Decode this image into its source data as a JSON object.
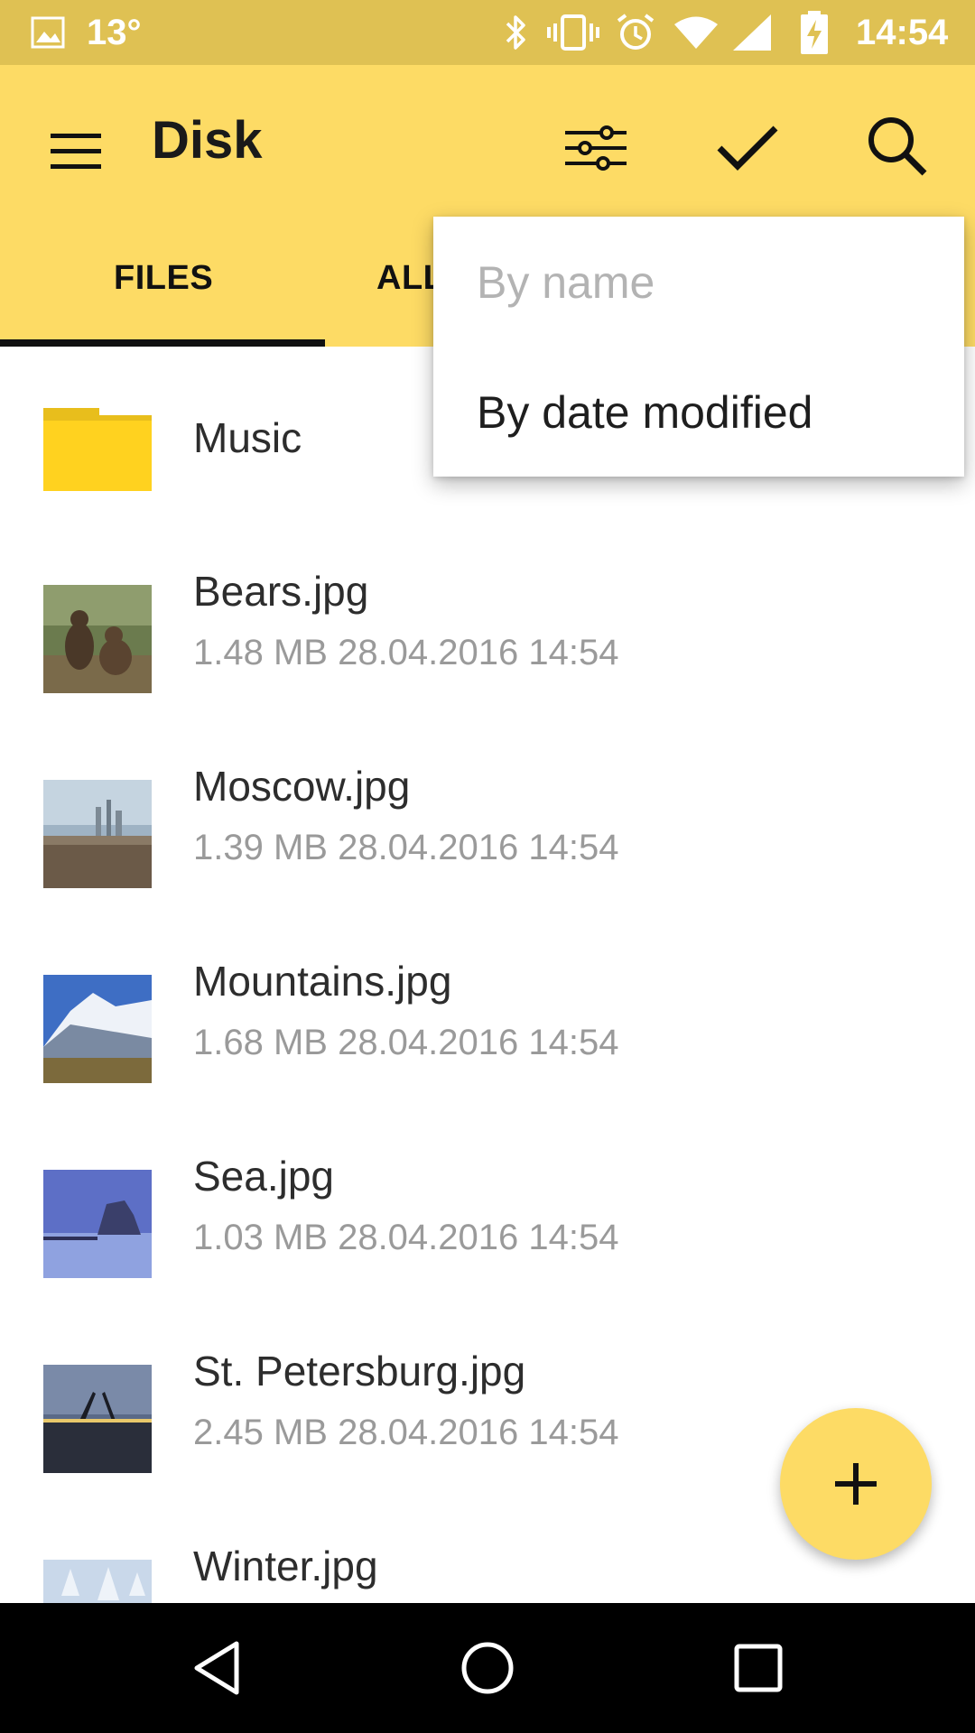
{
  "status_bar": {
    "temperature": "13°",
    "time": "14:54",
    "icons": [
      "image-icon",
      "bluetooth-icon",
      "vibrate-icon",
      "alarm-icon",
      "wifi-icon",
      "signal-icon",
      "battery-charging-icon"
    ]
  },
  "app_bar": {
    "title": "Disk",
    "menu_icon": "menu-icon",
    "actions": [
      "sort-filter-icon",
      "check-icon",
      "search-icon"
    ],
    "tabs": [
      {
        "label": "FILES",
        "active": true
      },
      {
        "label": "ALL",
        "active": false
      }
    ]
  },
  "sort_menu": {
    "items": [
      {
        "label": "By name",
        "enabled": false
      },
      {
        "label": "By date modified",
        "enabled": true
      }
    ]
  },
  "files": [
    {
      "name": "Music",
      "type": "folder"
    },
    {
      "name": "Bears.jpg",
      "meta": "1.48 MB 28.04.2016 14:54",
      "type": "image"
    },
    {
      "name": "Moscow.jpg",
      "meta": "1.39 MB 28.04.2016 14:54",
      "type": "image"
    },
    {
      "name": "Mountains.jpg",
      "meta": "1.68 MB 28.04.2016 14:54",
      "type": "image"
    },
    {
      "name": "Sea.jpg",
      "meta": "1.03 MB 28.04.2016 14:54",
      "type": "image"
    },
    {
      "name": "St. Petersburg.jpg",
      "meta": "2.45 MB 28.04.2016 14:54",
      "type": "image"
    },
    {
      "name": "Winter.jpg",
      "type": "image"
    }
  ],
  "fab": {
    "icon": "plus-icon"
  },
  "nav_bar": {
    "icons": [
      "back-icon",
      "home-icon",
      "recents-icon"
    ]
  },
  "colors": {
    "accent": "#fddb65",
    "status_bar": "#dfc153",
    "folder": "#ffd21f"
  }
}
